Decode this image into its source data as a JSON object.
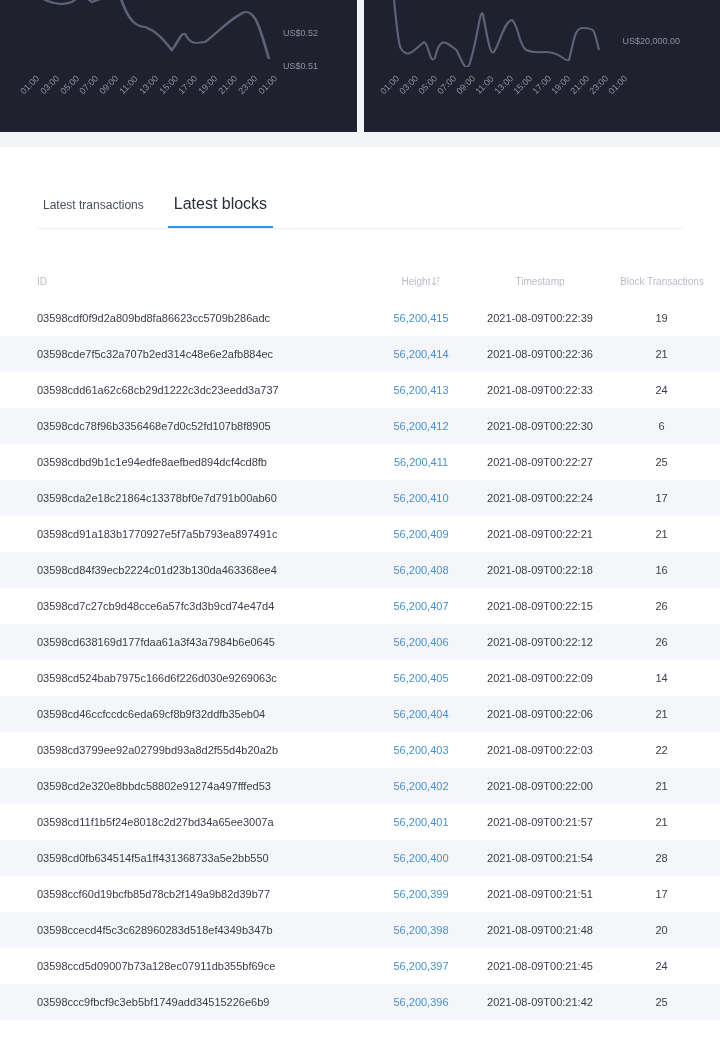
{
  "charts": [
    {
      "y_labels": [
        "US$0.52",
        "US$0.51"
      ],
      "x_labels": [
        "01:00",
        "03:00",
        "05:00",
        "07:00",
        "09:00",
        "11:00",
        "13:00",
        "15:00",
        "17:00",
        "19:00",
        "21:00",
        "23:00",
        "01:00"
      ]
    },
    {
      "y_labels": [
        "US$20,000.00"
      ],
      "x_labels": [
        "01:00",
        "03:00",
        "05:00",
        "07:00",
        "09:00",
        "11:00",
        "13:00",
        "15:00",
        "17:00",
        "19:00",
        "21:00",
        "23:00",
        "01:00"
      ]
    }
  ],
  "tabs": [
    {
      "label": "Latest transactions",
      "selected": false
    },
    {
      "label": "Latest blocks",
      "selected": true
    }
  ],
  "table": {
    "columns": [
      "ID",
      "Height",
      "Timestamp",
      "Block Transactions"
    ],
    "rows": [
      [
        "03598cdf0f9d2a809bd8fa86623cc5709b286adc",
        "56,200,415",
        "2021-08-09T00:22:39",
        "19"
      ],
      [
        "03598cde7f5c32a707b2ed314c48e6e2afb884ec",
        "56,200,414",
        "2021-08-09T00:22:36",
        "21"
      ],
      [
        "03598cdd61a62c68cb29d1222c3dc23eedd3a737",
        "56,200,413",
        "2021-08-09T00:22:33",
        "24"
      ],
      [
        "03598cdc78f96b3356468e7d0c52fd107b8f8905",
        "56,200,412",
        "2021-08-09T00:22:30",
        "6"
      ],
      [
        "03598cdbd9b1c1e94edfe8aefbed894dcf4cd8fb",
        "56,200,411",
        "2021-08-09T00:22:27",
        "25"
      ],
      [
        "03598cda2e18c21864c13378bf0e7d791b00ab60",
        "56,200,410",
        "2021-08-09T00:22:24",
        "17"
      ],
      [
        "03598cd91a183b1770927e5f7a5b793ea897491c",
        "56,200,409",
        "2021-08-09T00:22:21",
        "21"
      ],
      [
        "03598cd84f39ecb2224c01d23b130da463368ee4",
        "56,200,408",
        "2021-08-09T00:22:18",
        "16"
      ],
      [
        "03598cd7c27cb9d48cce6a57fc3d3b9cd74e47d4",
        "56,200,407",
        "2021-08-09T00:22:15",
        "26"
      ],
      [
        "03598cd638169d177fdaa61a3f43a7984b6e0645",
        "56,200,406",
        "2021-08-09T00:22:12",
        "26"
      ],
      [
        "03598cd524bab7975c166d6f226d030e9269063c",
        "56,200,405",
        "2021-08-09T00:22:09",
        "14"
      ],
      [
        "03598cd46ccfccdc6eda69cf8b9f32ddfb35eb04",
        "56,200,404",
        "2021-08-09T00:22:06",
        "21"
      ],
      [
        "03598cd3799ee92a02799bd93a8d2f55d4b20a2b",
        "56,200,403",
        "2021-08-09T00:22:03",
        "22"
      ],
      [
        "03598cd2e320e8bbdc58802e91274a497fffed53",
        "56,200,402",
        "2021-08-09T00:22:00",
        "21"
      ],
      [
        "03598cd11f1b5f24e8018c2d27bd34a65ee3007a",
        "56,200,401",
        "2021-08-09T00:21:57",
        "21"
      ],
      [
        "03598cd0fb634514f5a1ff431368733a5e2bb550",
        "56,200,400",
        "2021-08-09T00:21:54",
        "28"
      ],
      [
        "03598ccf60d19bcfb85d78cb2f149a9b82d39b77",
        "56,200,399",
        "2021-08-09T00:21:51",
        "17"
      ],
      [
        "03598ccecd4f5c3c628960283d518ef4349b347b",
        "56,200,398",
        "2021-08-09T00:21:48",
        "20"
      ],
      [
        "03598ccd5d09007b73a128ec07911db355bf69ce",
        "56,200,397",
        "2021-08-09T00:21:45",
        "24"
      ],
      [
        "03598ccc9fbcf9c3eb5bf1749add34515226e6b9",
        "56,200,396",
        "2021-08-09T00:21:42",
        "25"
      ]
    ]
  }
}
